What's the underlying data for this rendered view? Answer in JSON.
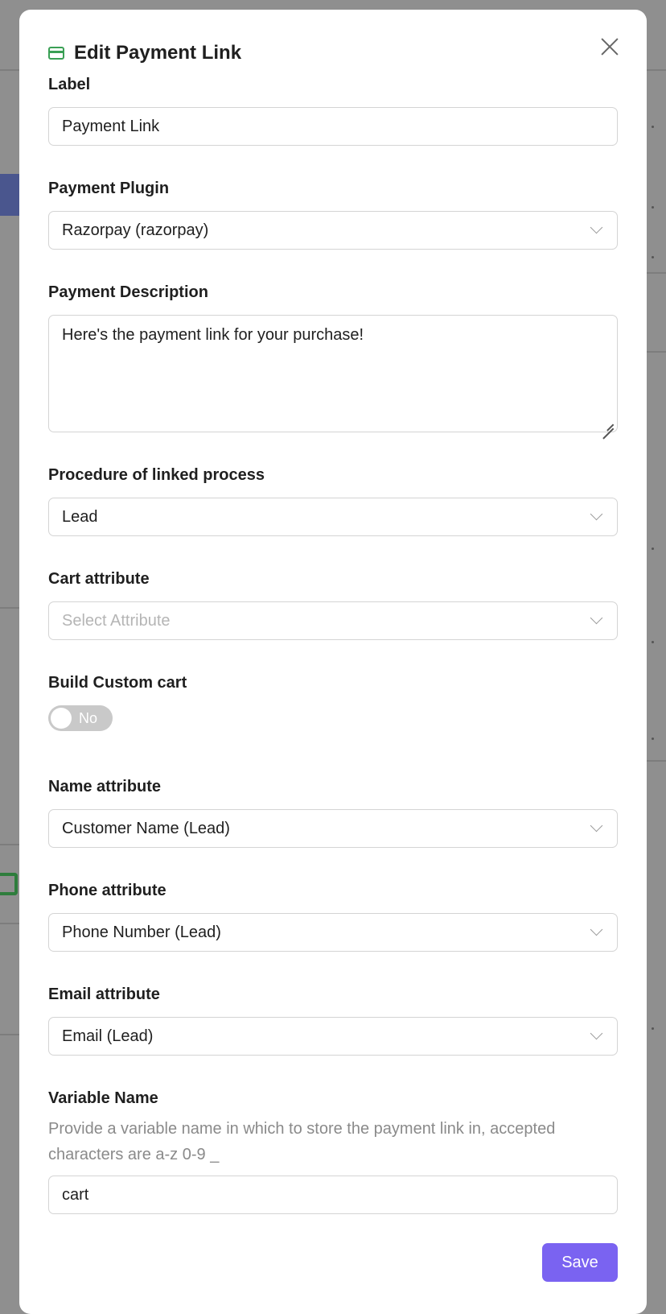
{
  "modal": {
    "title": "Edit Payment Link",
    "icon": "credit-card-icon",
    "accent_color": "#3aa055",
    "close_icon": "close-icon"
  },
  "fields": {
    "label": {
      "label": "Label",
      "value": "Payment Link"
    },
    "payment_plugin": {
      "label": "Payment Plugin",
      "value": "Razorpay (razorpay)"
    },
    "payment_description": {
      "label": "Payment Description",
      "value": "Here's the payment link for your purchase!"
    },
    "procedure": {
      "label": "Procedure of linked process",
      "value": "Lead"
    },
    "cart_attribute": {
      "label": "Cart attribute",
      "placeholder": "Select Attribute"
    },
    "build_custom_cart": {
      "label": "Build Custom cart",
      "toggle_text": "No",
      "enabled": false
    },
    "name_attribute": {
      "label": "Name attribute",
      "value": "Customer Name (Lead)"
    },
    "phone_attribute": {
      "label": "Phone attribute",
      "value": "Phone Number (Lead)"
    },
    "email_attribute": {
      "label": "Email attribute",
      "value": "Email (Lead)"
    },
    "variable_name": {
      "label": "Variable Name",
      "help": "Provide a variable name in which to store the payment link in, accepted characters are a-z 0-9 _",
      "value": "cart"
    }
  },
  "actions": {
    "save_label": "Save",
    "save_color": "#7a63f1"
  }
}
